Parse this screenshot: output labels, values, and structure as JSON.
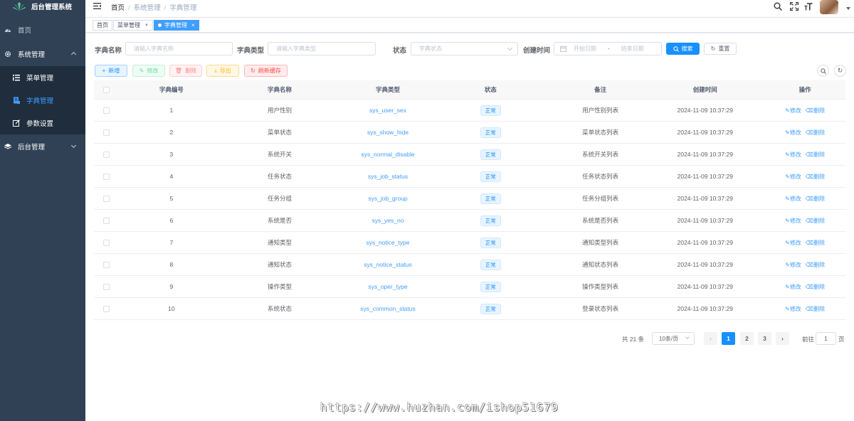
{
  "sidebar": {
    "title": "后台管理系统",
    "items": [
      {
        "label": "首页",
        "icon": "dashboard-icon"
      },
      {
        "label": "系统管理",
        "icon": "gear-icon",
        "expanded": true,
        "children": [
          {
            "label": "菜单管理",
            "icon": "tree-table-icon"
          },
          {
            "label": "字典管理",
            "icon": "dict-icon",
            "active": true
          },
          {
            "label": "参数设置",
            "icon": "edit-icon"
          }
        ]
      },
      {
        "label": "后台管理",
        "icon": "layers-icon",
        "expanded": false
      }
    ]
  },
  "breadcrumb": [
    "首页",
    "系统管理",
    "字典管理"
  ],
  "tags": [
    {
      "label": "首页"
    },
    {
      "label": "菜单管理"
    },
    {
      "label": "字典管理",
      "active": true
    }
  ],
  "search": {
    "dict_name_label": "字典名称",
    "dict_name_placeholder": "请输入字典名称",
    "dict_type_label": "字典类型",
    "dict_type_placeholder": "请输入字典类型",
    "status_label": "状态",
    "status_placeholder": "字典状态",
    "time_label": "创建时间",
    "start_placeholder": "开始日期",
    "range_sep": "-",
    "end_placeholder": "结束日期",
    "search_btn": "搜索",
    "reset_btn": "重置"
  },
  "toolbar": {
    "add": "新增",
    "edit": "修改",
    "delete": "删除",
    "export": "导出",
    "refresh_cache": "刷新缓存"
  },
  "table": {
    "headers": [
      "字典编号",
      "字典名称",
      "字典类型",
      "状态",
      "备注",
      "创建时间",
      "操作"
    ],
    "edit_label": "修改",
    "delete_label": "删除",
    "rows": [
      {
        "id": "1",
        "name": "用户性别",
        "type": "sys_user_sex",
        "status": "正常",
        "remark": "用户性别列表",
        "time": "2024-11-09 10:37:29"
      },
      {
        "id": "2",
        "name": "菜单状态",
        "type": "sys_show_hide",
        "status": "正常",
        "remark": "菜单状态列表",
        "time": "2024-11-09 10:37:29"
      },
      {
        "id": "3",
        "name": "系统开关",
        "type": "sys_normal_disable",
        "status": "正常",
        "remark": "系统开关列表",
        "time": "2024-11-09 10:37:29"
      },
      {
        "id": "4",
        "name": "任务状态",
        "type": "sys_job_status",
        "status": "正常",
        "remark": "任务状态列表",
        "time": "2024-11-09 10:37:29"
      },
      {
        "id": "5",
        "name": "任务分组",
        "type": "sys_job_group",
        "status": "正常",
        "remark": "任务分组列表",
        "time": "2024-11-09 10:37:29"
      },
      {
        "id": "6",
        "name": "系统是否",
        "type": "sys_yes_no",
        "status": "正常",
        "remark": "系统是否列表",
        "time": "2024-11-09 10:37:29"
      },
      {
        "id": "7",
        "name": "通知类型",
        "type": "sys_notice_type",
        "status": "正常",
        "remark": "通知类型列表",
        "time": "2024-11-09 10:37:29"
      },
      {
        "id": "8",
        "name": "通知状态",
        "type": "sys_notice_status",
        "status": "正常",
        "remark": "通知状态列表",
        "time": "2024-11-09 10:37:29"
      },
      {
        "id": "9",
        "name": "操作类型",
        "type": "sys_oper_type",
        "status": "正常",
        "remark": "操作类型列表",
        "time": "2024-11-09 10:37:29"
      },
      {
        "id": "10",
        "name": "系统状态",
        "type": "sys_common_status",
        "status": "正常",
        "remark": "登录状态列表",
        "time": "2024-11-09 10:37:29"
      }
    ]
  },
  "pagination": {
    "total": "共 21 条",
    "page_size": "10条/页",
    "pages": [
      "1",
      "2",
      "3"
    ],
    "current": "1",
    "goto_prefix": "前往",
    "goto_value": "1",
    "goto_suffix": "页"
  },
  "watermark": "https://www.huzhan.com/ishop51679",
  "colors": {
    "sidebar_bg": "#304156",
    "primary": "#1890ff",
    "active_menu": "#409eff"
  }
}
